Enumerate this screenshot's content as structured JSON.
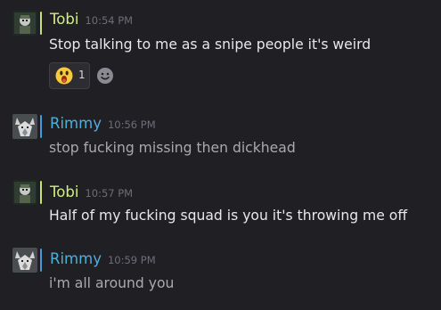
{
  "colors": {
    "background": "#202024",
    "tobi_name": "#d3f07a",
    "tobi_status": "#c8e26e",
    "rimmy_name": "#4eaee0",
    "rimmy_status": "#3b9ed6",
    "bright_text": "#e8e8ea",
    "muted_text": "#a9a9ae",
    "timestamp": "#6d6d73"
  },
  "messages": [
    {
      "author": "Tobi",
      "time": "10:54 PM",
      "text": "Stop talking to me as a snipe people it's weird",
      "avatar_icon": "soldier-avatar-icon",
      "reactions": [
        {
          "emoji_icon": "surprised-face-emoji-icon",
          "count": "1"
        }
      ],
      "add_reaction_icon": "add-reaction-smiley-icon"
    },
    {
      "author": "Rimmy",
      "time": "10:56 PM",
      "text": "stop fucking missing then dickhead",
      "avatar_icon": "wolf-avatar-icon"
    },
    {
      "author": "Tobi",
      "time": "10:57 PM",
      "text": "Half of my fucking squad is you it's throwing me off",
      "avatar_icon": "soldier-avatar-icon"
    },
    {
      "author": "Rimmy",
      "time": "10:59 PM",
      "text": "i'm all around you",
      "avatar_icon": "wolf-avatar-icon"
    }
  ]
}
